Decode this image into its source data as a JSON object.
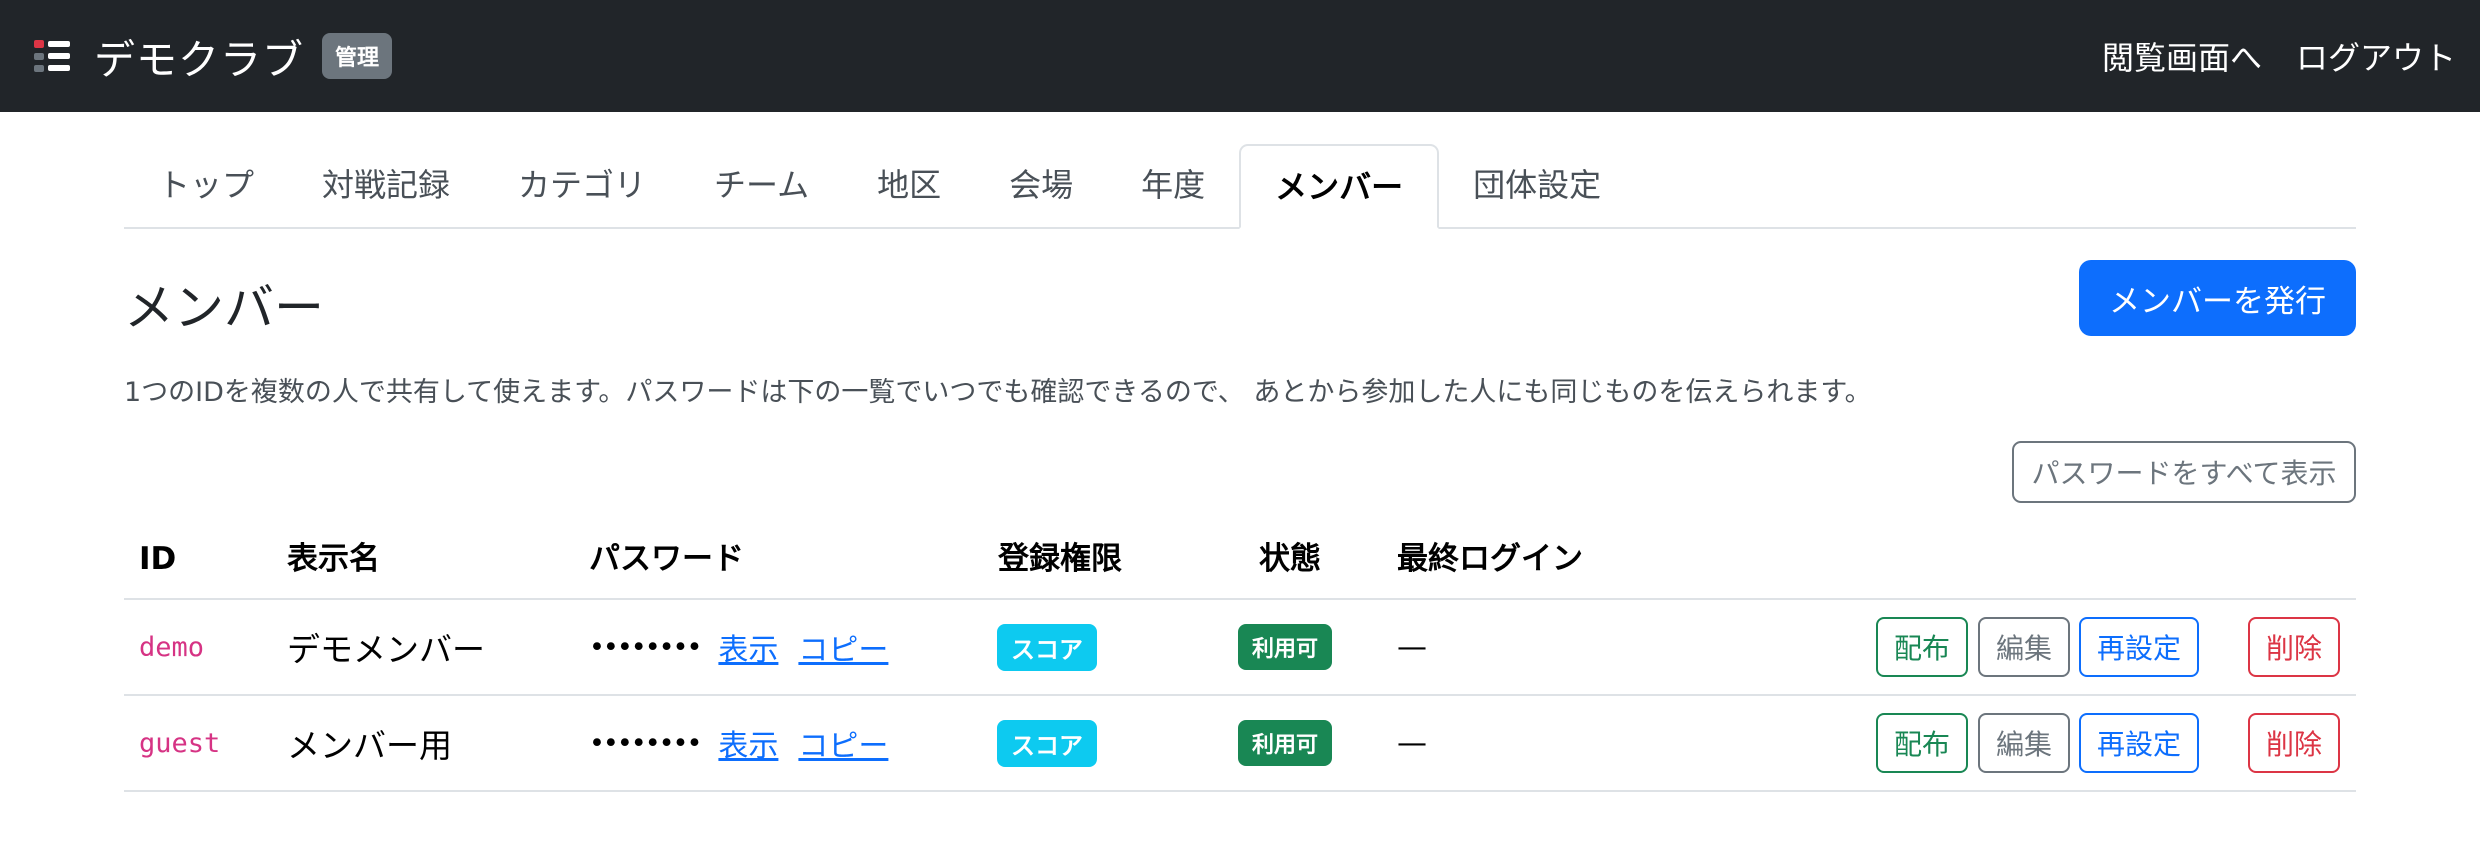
{
  "navbar": {
    "brand": "デモクラブ",
    "badge": "管理",
    "links": [
      "閲覧画面へ",
      "ログアウト"
    ]
  },
  "tabs": [
    {
      "label": "トップ",
      "active": false
    },
    {
      "label": "対戦記録",
      "active": false
    },
    {
      "label": "カテゴリ",
      "active": false
    },
    {
      "label": "チーム",
      "active": false
    },
    {
      "label": "地区",
      "active": false
    },
    {
      "label": "会場",
      "active": false
    },
    {
      "label": "年度",
      "active": false
    },
    {
      "label": "メンバー",
      "active": true
    },
    {
      "label": "団体設定",
      "active": false
    }
  ],
  "page": {
    "title": "メンバー",
    "issue_button": "メンバーを発行",
    "description": "1つのIDを複数の人で共有して使えます。パスワードは下の一覧でいつでも確認できるので、 あとから参加した人にも同じものを伝えられます。",
    "show_all_button": "パスワードをすべて表示"
  },
  "table": {
    "headers": [
      "ID",
      "表示名",
      "パスワード",
      "登録権限",
      "状態",
      "最終ログイン"
    ],
    "rows": [
      {
        "id": "demo",
        "display_name": "デモメンバー",
        "password": "••••••••",
        "show": "表示",
        "copy": "コピー",
        "permission": "スコア",
        "status": "利用可",
        "last_login": "—"
      },
      {
        "id": "guest",
        "display_name": "メンバー用",
        "password": "••••••••",
        "show": "表示",
        "copy": "コピー",
        "permission": "スコア",
        "status": "利用可",
        "last_login": "—"
      }
    ],
    "actions": {
      "distribute": "配布",
      "edit": "編集",
      "reset": "再設定",
      "delete": "削除"
    }
  },
  "colors": {
    "navbar_bg": "#212529",
    "primary": "#0d6efd",
    "info_badge": "#0dcaf0",
    "success": "#198754",
    "danger": "#dc3545",
    "code": "#d63384"
  }
}
